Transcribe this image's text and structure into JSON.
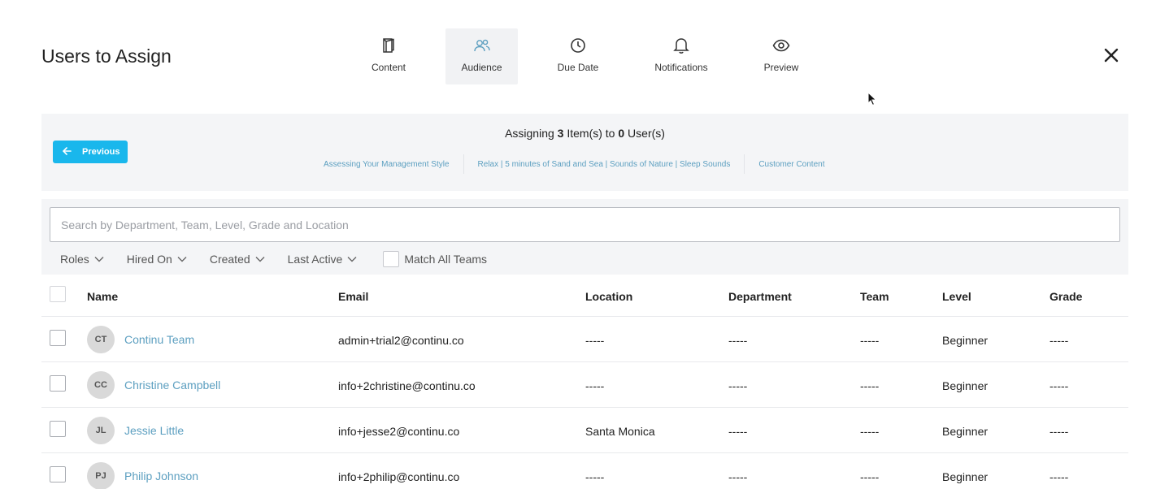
{
  "header": {
    "title": "Users to Assign",
    "close_icon": "close-icon"
  },
  "steps": [
    {
      "label": "Content",
      "icon": "book-icon",
      "active": false
    },
    {
      "label": "Audience",
      "icon": "users-icon",
      "active": true
    },
    {
      "label": "Due Date",
      "icon": "clock-icon",
      "active": false
    },
    {
      "label": "Notifications",
      "icon": "bell-icon",
      "active": false
    },
    {
      "label": "Preview",
      "icon": "eye-icon",
      "active": false
    }
  ],
  "assign": {
    "previous_label": "Previous",
    "summary_prefix": "Assigning",
    "item_count": "3",
    "summary_middle": "Item(s) to",
    "user_count": "0",
    "summary_suffix": "User(s)",
    "items": [
      "Assessing Your Management Style",
      "Relax | 5 minutes of Sand and Sea | Sounds of Nature | Sleep Sounds",
      "Customer Content"
    ]
  },
  "filters": {
    "search_placeholder": "Search by Department, Team, Level, Grade and Location",
    "dropdowns": [
      "Roles",
      "Hired On",
      "Created",
      "Last Active"
    ],
    "match_all_teams": "Match All Teams"
  },
  "table": {
    "columns": [
      "Name",
      "Email",
      "Location",
      "Department",
      "Team",
      "Level",
      "Grade"
    ],
    "rows": [
      {
        "initials": "CT",
        "name": "Continu Team",
        "email": "admin+trial2@continu.co",
        "location": "-----",
        "department": "-----",
        "team": "-----",
        "level": "Beginner",
        "grade": "-----"
      },
      {
        "initials": "CC",
        "name": "Christine Campbell",
        "email": "info+2christine@continu.co",
        "location": "-----",
        "department": "-----",
        "team": "-----",
        "level": "Beginner",
        "grade": "-----"
      },
      {
        "initials": "JL",
        "name": "Jessie Little",
        "email": "info+jesse2@continu.co",
        "location": "Santa Monica",
        "department": "-----",
        "team": "-----",
        "level": "Beginner",
        "grade": "-----"
      },
      {
        "initials": "PJ",
        "name": "Philip Johnson",
        "email": "info+2philip@continu.co",
        "location": "-----",
        "department": "-----",
        "team": "-----",
        "level": "Beginner",
        "grade": "-----"
      }
    ]
  },
  "colors": {
    "accent": "#19b7ec",
    "link": "#5c9fc0",
    "panel_bg": "#f4f5f7"
  }
}
